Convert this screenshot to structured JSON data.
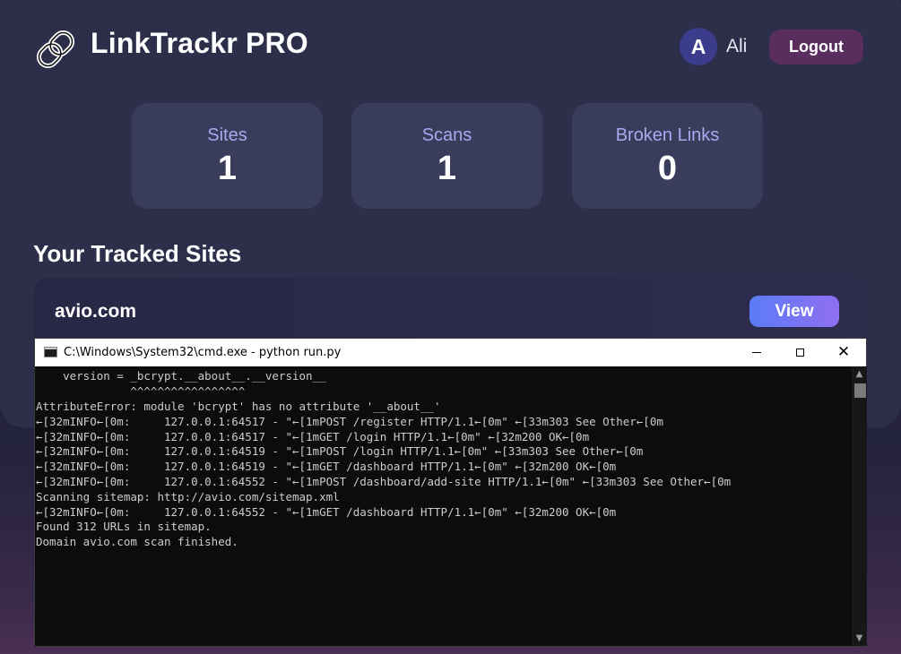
{
  "app": {
    "title": "LinkTrackr PRO",
    "logo_icon": "chain-link-icon"
  },
  "user": {
    "avatar_initial": "A",
    "name": "Ali",
    "logout_label": "Logout"
  },
  "stats": [
    {
      "label": "Sites",
      "value": "1"
    },
    {
      "label": "Scans",
      "value": "1"
    },
    {
      "label": "Broken Links",
      "value": "0"
    }
  ],
  "sites_section": {
    "title": "Your Tracked Sites",
    "sites": [
      {
        "name": "avio.com",
        "view_label": "View"
      }
    ]
  },
  "console": {
    "title": "C:\\Windows\\System32\\cmd.exe - python  run.py",
    "lines": [
      "    version = _bcrypt.__about__.__version__",
      "              ^^^^^^^^^^^^^^^^^",
      "AttributeError: module 'bcrypt' has no attribute '__about__'",
      "←[32mINFO←[0m:     127.0.0.1:64517 - \"←[1mPOST /register HTTP/1.1←[0m\" ←[33m303 See Other←[0m",
      "←[32mINFO←[0m:     127.0.0.1:64517 - \"←[1mGET /login HTTP/1.1←[0m\" ←[32m200 OK←[0m",
      "←[32mINFO←[0m:     127.0.0.1:64519 - \"←[1mPOST /login HTTP/1.1←[0m\" ←[33m303 See Other←[0m",
      "←[32mINFO←[0m:     127.0.0.1:64519 - \"←[1mGET /dashboard HTTP/1.1←[0m\" ←[32m200 OK←[0m",
      "←[32mINFO←[0m:     127.0.0.1:64552 - \"←[1mPOST /dashboard/add-site HTTP/1.1←[0m\" ←[33m303 See Other←[0m",
      "Scanning sitemap: http://avio.com/sitemap.xml",
      "←[32mINFO←[0m:     127.0.0.1:64552 - \"←[1mGET /dashboard HTTP/1.1←[0m\" ←[32m200 OK←[0m",
      "Found 312 URLs in sitemap.",
      "Domain avio.com scan finished."
    ]
  },
  "colors": {
    "card_bg": "#2d2f4a",
    "stat_bg": "#3a3c5c",
    "stat_label": "#a8a9ef",
    "logout_bg": "#5a2d5f",
    "view_gradient_start": "#5b7cf6",
    "view_gradient_end": "#8f6ff2",
    "console_bg": "#0c0c0c",
    "console_text": "#cccccc"
  }
}
